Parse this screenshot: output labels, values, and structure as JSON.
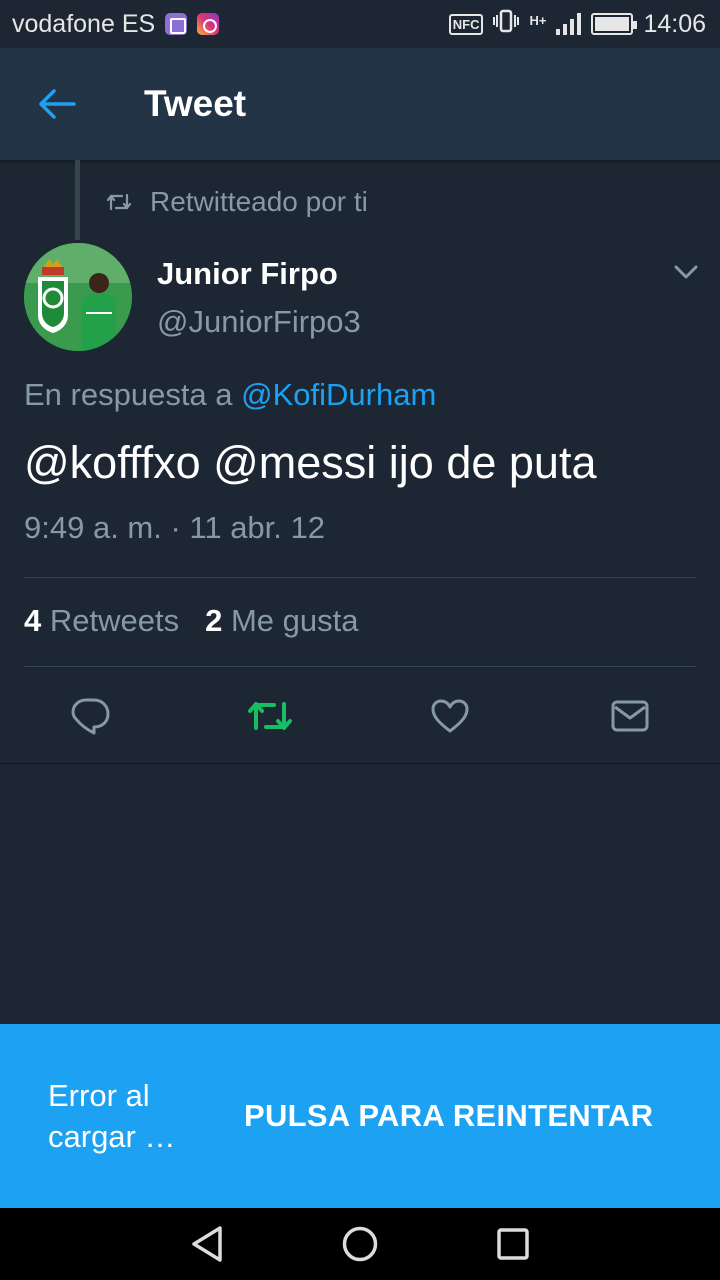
{
  "status_bar": {
    "carrier": "vodafone ES",
    "nfc": "NFC",
    "network": "H+",
    "time": "14:06",
    "icons": [
      "gallery-icon",
      "instagram-icon",
      "nfc-icon",
      "vibrate-icon",
      "signal-icon",
      "battery-icon"
    ]
  },
  "header": {
    "title": "Tweet",
    "back_icon": "arrow-left-icon"
  },
  "retweet": {
    "label": "Retwitteado por ti",
    "icon": "retweet-icon"
  },
  "tweet": {
    "author_name": "Junior Firpo",
    "author_handle": "@JuniorFirpo3",
    "reply_prefix": "En respuesta a",
    "reply_to": "@KofiDurham",
    "text": "@kofffxo @messi ijo de puta",
    "timestamp": "9:49 a. m. · 11 abr. 12",
    "retweets_count": "4",
    "retweets_label": "Retweets",
    "likes_count": "2",
    "likes_label": "Me gusta"
  },
  "actions": [
    {
      "name": "reply",
      "icon": "reply-icon"
    },
    {
      "name": "retweet",
      "icon": "retweet-icon",
      "active": true
    },
    {
      "name": "like",
      "icon": "heart-icon"
    },
    {
      "name": "message",
      "icon": "envelope-icon"
    }
  ],
  "snackbar": {
    "message": "Error al cargar …",
    "action": "PULSA PARA REINTENTAR"
  },
  "colors": {
    "background": "#1c2733",
    "header": "#243447",
    "accent": "#1da1f2",
    "secondary_text": "#8899a6",
    "retweet_active": "#17bf63",
    "divider": "#38444d"
  }
}
